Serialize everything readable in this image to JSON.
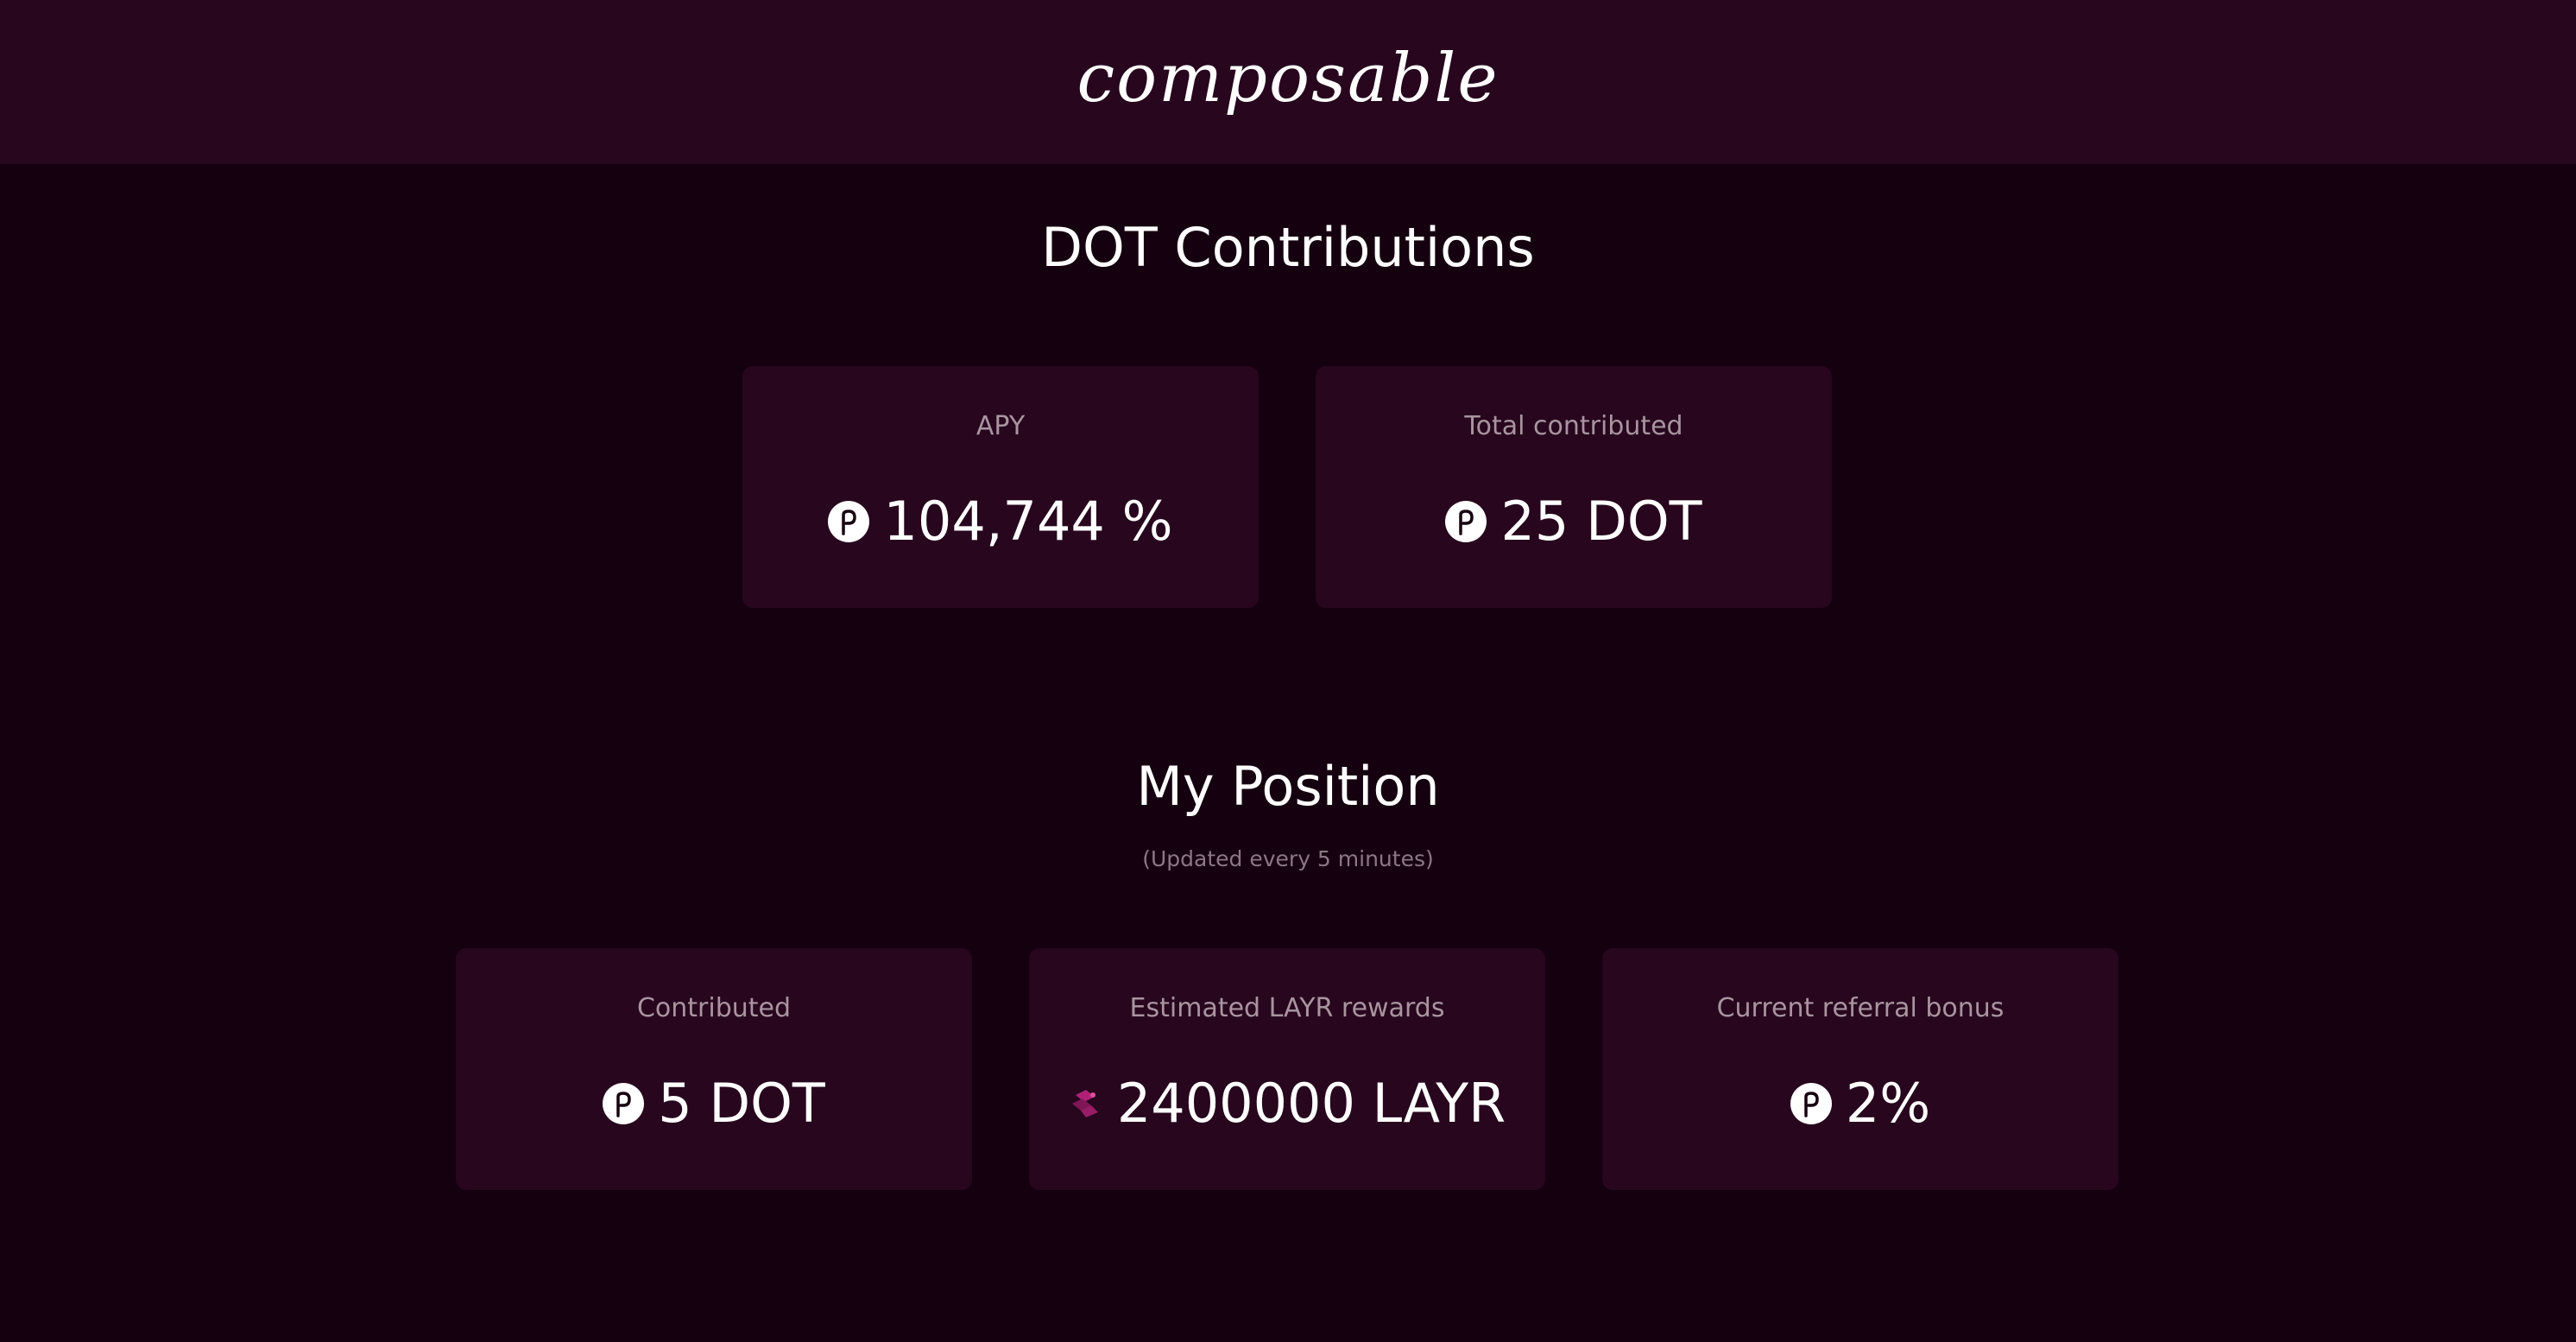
{
  "header": {
    "logo_text": "composable"
  },
  "contributions": {
    "title": "DOT Contributions",
    "cards": [
      {
        "label": "APY",
        "value": "104,744 %",
        "icon": "polkadot-icon"
      },
      {
        "label": "Total contributed",
        "value": "25 DOT",
        "icon": "polkadot-icon"
      }
    ]
  },
  "position": {
    "title": "My Position",
    "subtitle": "(Updated every 5 minutes)",
    "cards": [
      {
        "label": "Contributed",
        "value": "5 DOT",
        "icon": "polkadot-icon"
      },
      {
        "label": "Estimated LAYR rewards",
        "value": "2400000 LAYR",
        "icon": "layr-icon"
      },
      {
        "label": "Current referral bonus",
        "value": "2%",
        "icon": "polkadot-icon"
      }
    ]
  },
  "colors": {
    "background": "#15000f",
    "header_bg": "#27061e",
    "card_bg": "#27061e",
    "label": "#a9949f",
    "subtitle": "#8b7785",
    "layr_accent": "#c0257f"
  }
}
